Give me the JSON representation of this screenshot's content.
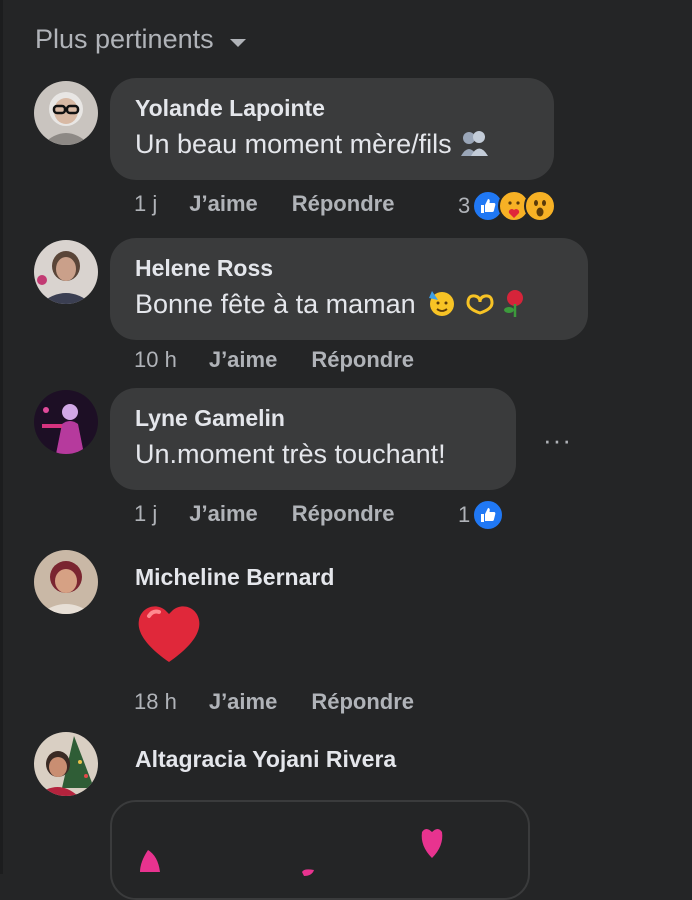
{
  "sort": {
    "label": "Plus pertinents"
  },
  "comments": [
    {
      "name": "Yolande Lapointe",
      "text": "Un beau moment mère/fils",
      "time": "1 j",
      "like": "J’aime",
      "reply": "Répondre",
      "reaction_count": "3",
      "reactions": [
        "like-icon",
        "care-icon",
        "wow-icon"
      ]
    },
    {
      "name": "Helene Ross",
      "text": "Bonne fête à ta maman",
      "time": "10 h",
      "like": "J’aime",
      "reply": "Répondre"
    },
    {
      "name": "Lyne Gamelin",
      "text": "Un.moment très touchant!",
      "time": "1 j",
      "like": "J’aime",
      "reply": "Répondre",
      "reaction_count": "1",
      "reactions": [
        "like-icon"
      ],
      "more": "···"
    },
    {
      "name": "Micheline Bernard",
      "text": "",
      "time": "18 h",
      "like": "J’aime",
      "reply": "Répondre"
    },
    {
      "name": "Altagracia Yojani Rivera"
    }
  ],
  "colors": {
    "background": "#242526",
    "bubble": "#3a3b3c",
    "like_blue": "#2078f4",
    "secondary_text": "#b0b3b8",
    "heart_red": "#e0283a",
    "sticker_pink": "#e8338f"
  }
}
